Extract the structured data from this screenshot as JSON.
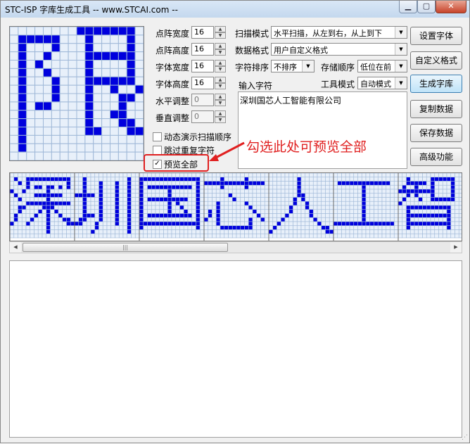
{
  "window": {
    "title": "STC-ISP 字库生成工具 -- www.STCAI.com --"
  },
  "params": [
    {
      "id": "dot-width",
      "label": "点阵宽度",
      "value": "16",
      "enabled": true
    },
    {
      "id": "dot-height",
      "label": "点阵高度",
      "value": "16",
      "enabled": true
    },
    {
      "id": "font-width",
      "label": "字体宽度",
      "value": "16",
      "enabled": true
    },
    {
      "id": "font-height",
      "label": "字体高度",
      "value": "16",
      "enabled": true
    },
    {
      "id": "h-adjust",
      "label": "水平调整",
      "value": "0",
      "enabled": false
    },
    {
      "id": "v-adjust",
      "label": "垂直调整",
      "value": "0",
      "enabled": false
    }
  ],
  "scan_mode": {
    "label": "扫描模式",
    "value": "水平扫描，从左到右，从上到下"
  },
  "data_format": {
    "label": "数据格式",
    "value": "用户自定义格式"
  },
  "char_sort": {
    "label": "字符排序",
    "value": "不排序"
  },
  "store_order": {
    "label": "存储顺序",
    "value": "低位在前"
  },
  "tool_mode": {
    "label": "工具模式",
    "value": "自动模式"
  },
  "input": {
    "label": "输入字符",
    "value": "深圳国芯人工智能有限公司"
  },
  "checkboxes": [
    {
      "id": "anim-scan",
      "label": "动态演示扫描顺序",
      "checked": false
    },
    {
      "id": "skip-dup",
      "label": "跳过重复字符",
      "checked": false
    },
    {
      "id": "preview-all",
      "label": "预览全部",
      "checked": true
    }
  ],
  "buttons": [
    {
      "id": "set-font",
      "label": "设置字体"
    },
    {
      "id": "custom-format",
      "label": "自定义格式"
    },
    {
      "id": "gen-lib",
      "label": "生成字库"
    },
    {
      "id": "copy-data",
      "label": "复制数据"
    },
    {
      "id": "save-data",
      "label": "保存数据"
    },
    {
      "id": "advanced",
      "label": "高级功能"
    }
  ],
  "annotation": "勾选此处可预览全部",
  "colors": {
    "pixel_on": "#0000dd",
    "grid": "#9fb8d8",
    "annotation": "#e02020"
  },
  "preview_glyph": "限",
  "strip_glyphs": [
    "深",
    "圳",
    "国",
    "芯",
    "人",
    "工",
    "智"
  ]
}
